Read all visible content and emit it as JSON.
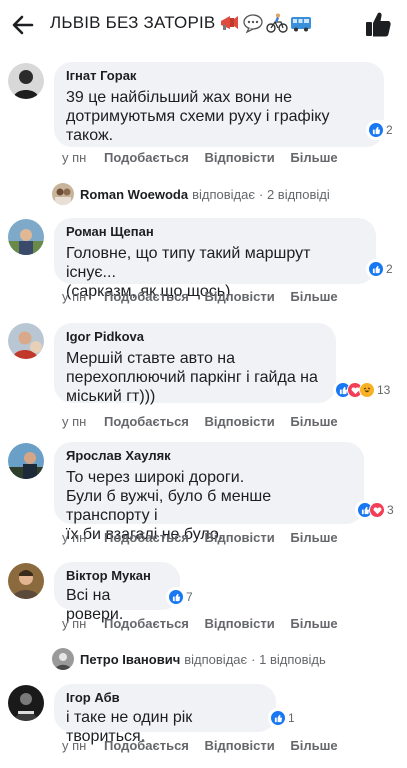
{
  "header": {
    "title": "ЛЬВІВ БЕЗ ЗАТОРІВ",
    "title_icons": [
      "megaphone-emoji",
      "speech-bubble-emoji",
      "cyclist-emoji",
      "bus-emoji"
    ]
  },
  "comments": [
    {
      "author": "Ігнат Горак",
      "text": "39 це найбільший жах вони не\nдотримуютьмя схеми руху і графіку\nтакож.",
      "time": "у пн",
      "like": "Подобається",
      "reply": "Відповісти",
      "more": "Більше",
      "reactions": [
        "like"
      ],
      "reaction_count": "2"
    },
    {
      "author": "Роман Щепан",
      "text": "Головне, що типу такий маршрут існує...\n(сарказм, як що щось)",
      "time": "у пн",
      "like": "Подобається",
      "reply": "Відповісти",
      "more": "Більше",
      "reactions": [
        "like"
      ],
      "reaction_count": "2"
    },
    {
      "author": "Igor Pidkova",
      "text": "Мершій ставте авто на\nперехоплюючий паркінг і гайда на\nміський гт)))",
      "time": "у пн",
      "like": "Подобається",
      "reply": "Відповісти",
      "more": "Більше",
      "reactions": [
        "like",
        "love",
        "haha"
      ],
      "reaction_count": "13"
    },
    {
      "author": "Ярослав Хауляк",
      "text": "То через широкі дороги.\nБули б вужчі, було б менше транспорту і\nїх би взагалі не було.",
      "time": "у пн",
      "like": "Подобається",
      "reply": "Відповісти",
      "more": "Більше",
      "reactions": [
        "like",
        "love"
      ],
      "reaction_count": "3"
    },
    {
      "author": "Віктор Мукан",
      "text": "Всі на ровери.",
      "time": "у пн",
      "like": "Подобається",
      "reply": "Відповісти",
      "more": "Більше",
      "reactions": [
        "like"
      ],
      "reaction_count": "7"
    },
    {
      "author": "Ігор Абв",
      "text": "і таке не один рік твориться.",
      "time": "у пн",
      "like": "Подобається",
      "reply": "Відповісти",
      "more": "Більше",
      "reactions": [
        "like"
      ],
      "reaction_count": "1"
    }
  ],
  "reply_threads": [
    {
      "name": "Roman Woewoda",
      "verb": "відповідає",
      "count": "· 2 відповіді"
    },
    {
      "name": "Петро Іванович",
      "verb": "відповідає",
      "count": "· 1 відповідь"
    }
  ],
  "colors": {
    "bubble": "#f0f2f5",
    "meta": "#65676b",
    "like_blue": "#1877f2",
    "love_red": "#f33e58",
    "haha_yellow": "#f7b125"
  }
}
